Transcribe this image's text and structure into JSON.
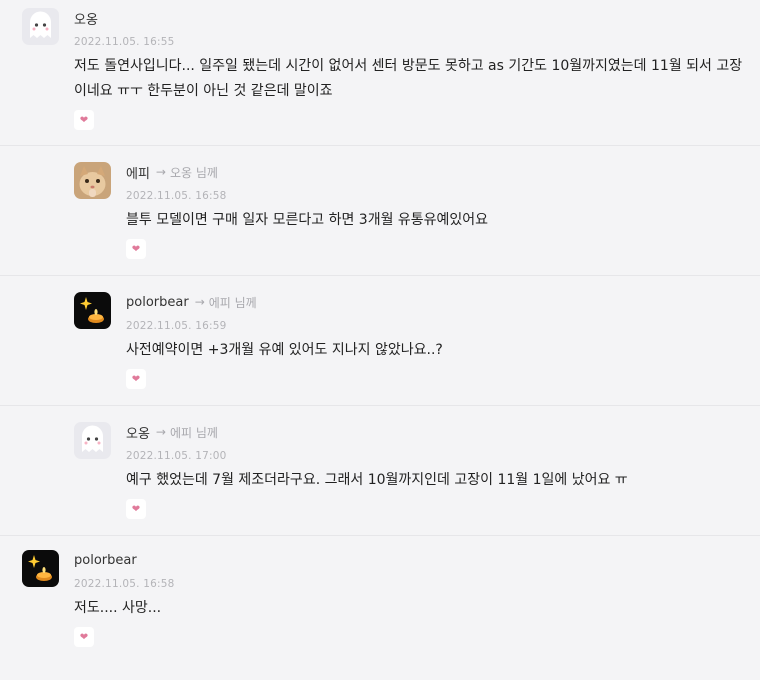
{
  "comments": [
    {
      "author": "오옹",
      "date": "2022.11.05. 16:55",
      "text": "저도 돌연사입니다... 일주일 됐는데 시간이 없어서 센터 방문도 못하고 as 기간도 10월까지였는데 11월 되서 고장이네요 ㅠㅜ 한두분이 아닌 것 같은데 말이죠",
      "avatar_icon": "ghost-avatar"
    },
    {
      "author": "에피",
      "reply_to": "오옹 님께",
      "date": "2022.11.05. 16:58",
      "text": "블투 모델이면 구매 일자 모른다고 하면 3개월 유통유예있어요",
      "avatar_icon": "cat-avatar"
    },
    {
      "author": "polorbear",
      "reply_to": "에피 님께",
      "date": "2022.11.05. 16:59",
      "text": "사전예약이면 +3개월 유예 있어도 지나지 않았나요..?",
      "avatar_icon": "candle-avatar"
    },
    {
      "author": "오옹",
      "reply_to": "에피 님께",
      "date": "2022.11.05. 17:00",
      "text": "예구 했었는데 7월 제조더라구요. 그래서 10월까지인데 고장이 11월 1일에 났어요 ㅠ",
      "avatar_icon": "ghost-avatar"
    },
    {
      "author": "polorbear",
      "date": "2022.11.05. 16:58",
      "text": "저도.... 사망...",
      "avatar_icon": "candle-avatar"
    }
  ],
  "arrow_glyph": "→",
  "like_icon": "heart-icon",
  "colors": {
    "like": "#e07a9a",
    "background": "#f4f4f6"
  }
}
